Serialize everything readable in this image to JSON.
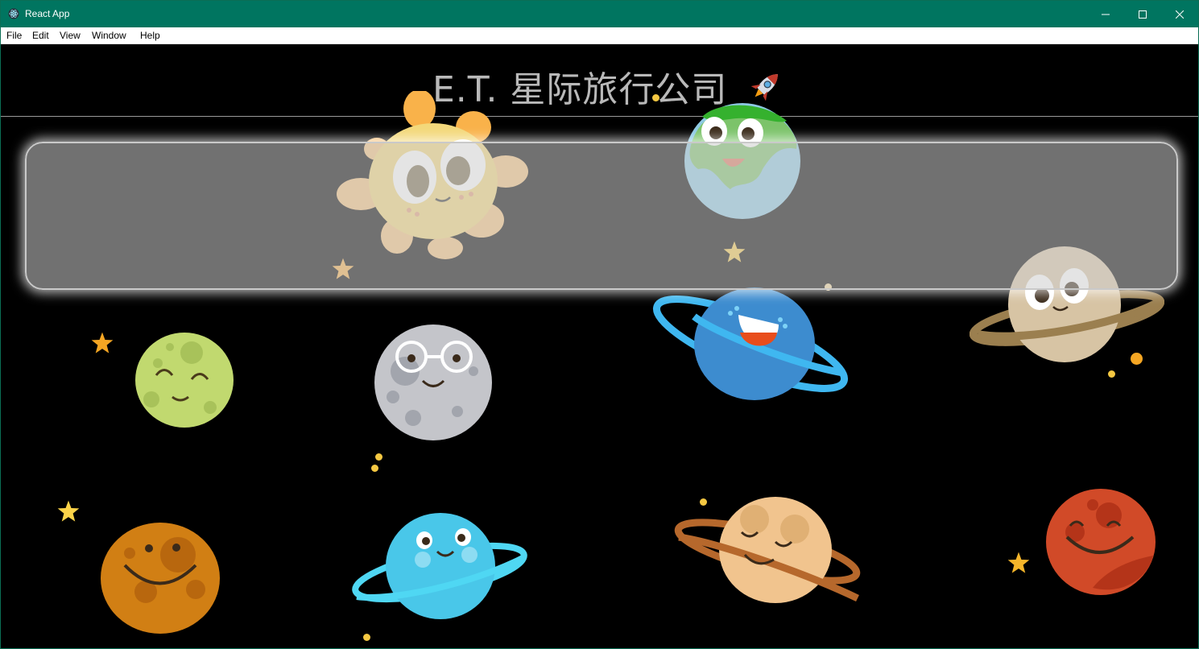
{
  "window": {
    "title": "React App",
    "icon": "electron-atom-icon",
    "controls": [
      "minimize-icon",
      "maximize-icon",
      "close-icon"
    ]
  },
  "menu": {
    "file": "File",
    "edit": "Edit",
    "view": "View",
    "window": "Window",
    "help": "Help"
  },
  "page": {
    "heading": "E.T. 星际旅行公司",
    "heading_icon": "rocket-icon"
  },
  "colors": {
    "titlebar": "#007560",
    "background": "#000000",
    "heading_text": "#b9b9b9"
  }
}
